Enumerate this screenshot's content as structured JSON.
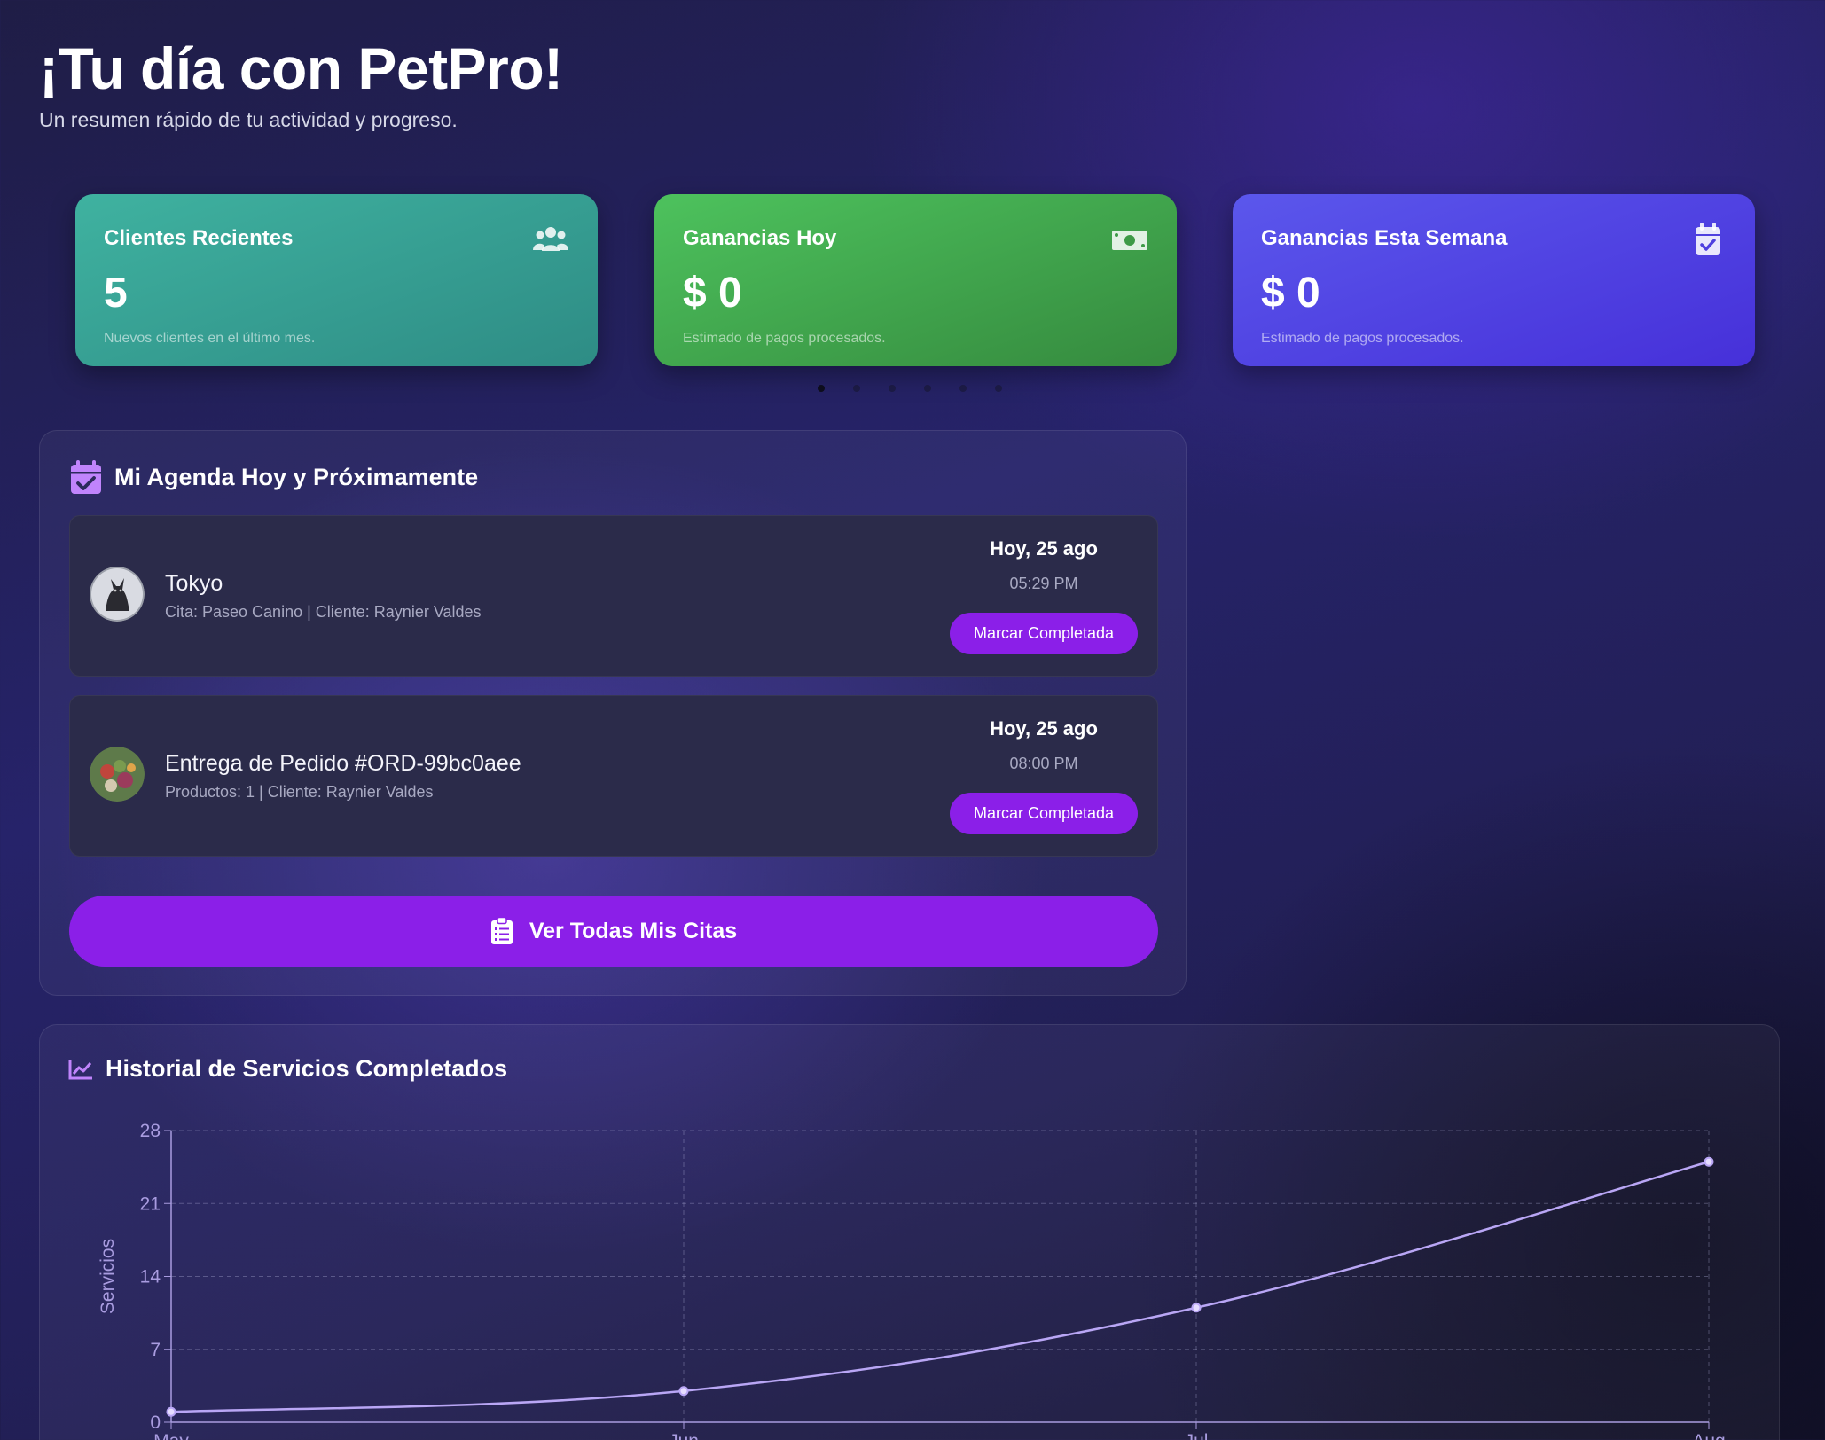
{
  "header": {
    "title": "¡Tu día con PetPro!",
    "subtitle": "Un resumen rápido de tu actividad y progreso."
  },
  "stats": [
    {
      "title": "Clientes Recientes",
      "value": "5",
      "sub": "Nuevos clientes en el último mes.",
      "icon": "users-icon",
      "color": "#3fb2a0"
    },
    {
      "title": "Ganancias Hoy",
      "value": "$ 0",
      "sub": "Estimado de pagos procesados.",
      "icon": "money-icon",
      "color": "#4dc25d"
    },
    {
      "title": "Ganancias Esta Semana",
      "value": "$ 0",
      "sub": "Estimado de pagos procesados.",
      "icon": "calendar-check-icon",
      "color": "#5b57ec"
    }
  ],
  "carousel": {
    "count": 6,
    "active": 0
  },
  "agenda": {
    "title": "Mi Agenda Hoy y Próximamente",
    "items": [
      {
        "name": "Tokyo",
        "desc": "Cita: Paseo Canino | Cliente: Raynier Valdes",
        "date": "Hoy, 25 ago",
        "time": "05:29 PM",
        "action": "Marcar Completada"
      },
      {
        "name": "Entrega de Pedido #ORD-99bc0aee",
        "desc": "Productos: 1 | Cliente: Raynier Valdes",
        "date": "Hoy, 25 ago",
        "time": "08:00 PM",
        "action": "Marcar Completada"
      }
    ],
    "view_all": "Ver Todas Mis Citas"
  },
  "history": {
    "title": "Historial de Servicios Completados"
  },
  "colors": {
    "accent": "#8b1fe8",
    "line": "#b9a6f5"
  },
  "chart_data": {
    "type": "line",
    "x": [
      "May",
      "Jun",
      "Jul",
      "Aug"
    ],
    "y": [
      1,
      3,
      11,
      25
    ],
    "ylabel": "Servicios",
    "xlabel": "",
    "ylim": [
      0,
      28
    ],
    "yticks": [
      0,
      7,
      14,
      21,
      28
    ],
    "grid": true,
    "smooth": true
  }
}
